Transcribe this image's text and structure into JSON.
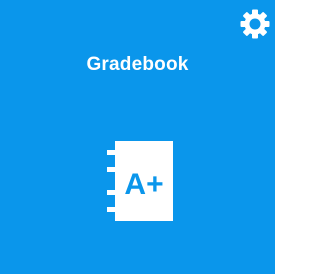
{
  "tile": {
    "title": "Gradebook",
    "icon_text": "A+",
    "background_color": "#0A96EB",
    "foreground_color": "#FFFFFF",
    "icons": {
      "settings": "gear-icon",
      "app": "gradebook-notebook-icon"
    }
  }
}
